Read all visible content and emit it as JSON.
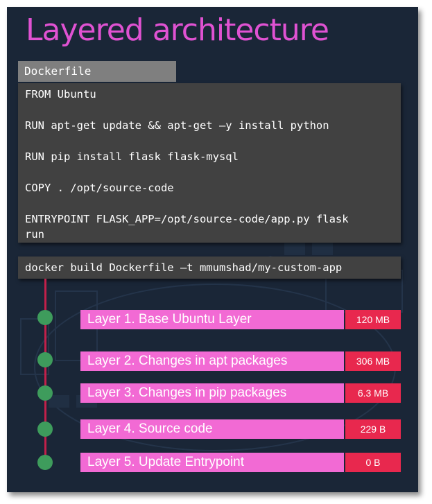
{
  "slide": {
    "title": "Layered architecture"
  },
  "dockerfile": {
    "tab_label": "Dockerfile",
    "lines": [
      "FROM Ubuntu",
      "RUN apt-get update && apt-get –y install python",
      "RUN pip install flask flask-mysql",
      "COPY . /opt/source-code",
      "ENTRYPOINT FLASK_APP=/opt/source-code/app.py flask",
      "run"
    ]
  },
  "command": "docker build Dockerfile –t mmumshad/my-custom-app",
  "layers": [
    {
      "label": "Layer 1. Base Ubuntu Layer",
      "size": "120 MB"
    },
    {
      "label": "Layer 2. Changes in apt packages",
      "size": "306 MB"
    },
    {
      "label": "Layer 3. Changes in pip packages",
      "size": "6.3 MB"
    },
    {
      "label": "Layer 4. Source code",
      "size": "229 B"
    },
    {
      "label": "Layer 5. Update Entrypoint",
      "size": "0 B"
    }
  ],
  "colors": {
    "title": "#e052d2",
    "layer_bar": "#f26ad4",
    "size_box": "#e8284e",
    "timeline_line": "#c2204a",
    "timeline_dot": "#3e9c5c",
    "background": "#1a2637"
  }
}
